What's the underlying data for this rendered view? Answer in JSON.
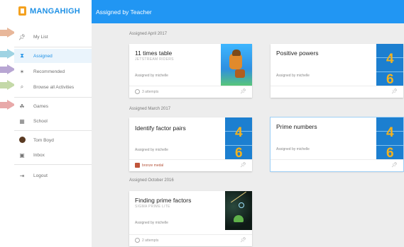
{
  "brand": {
    "name": "MANGAHIGH"
  },
  "topbar": {
    "title": "Assigned by Teacher"
  },
  "sidebar": {
    "items": [
      {
        "label": "My List",
        "icon": "pin-icon"
      },
      {
        "label": "Assigned",
        "icon": "hourglass-icon",
        "active": true
      },
      {
        "label": "Recommended",
        "icon": "magic-wand-icon"
      },
      {
        "label": "Browse all Activities",
        "icon": "search-icon"
      },
      {
        "label": "Games",
        "icon": "gamepad-icon"
      },
      {
        "label": "School",
        "icon": "school-icon"
      },
      {
        "label": "Tom Boyd",
        "icon": "avatar"
      },
      {
        "label": "Inbox",
        "icon": "inbox-icon"
      },
      {
        "label": "Logout",
        "icon": "logout-icon"
      }
    ]
  },
  "colors": {
    "accent": "#2196f3",
    "brand_orange": "#f4a11f",
    "tile_blue": "#1c7fd0",
    "digit_yellow": "#f4b31e"
  },
  "sections": [
    {
      "heading": "Assigned April 2017",
      "cards": [
        {
          "title": "11 times table",
          "subtitle": "JETSTREAM RIDERS",
          "assigned_by": "Assigned by michelle",
          "footer": "3 attempts",
          "thumb_digits": []
        },
        {
          "title": "Positive powers",
          "assigned_by": "Assigned by michelle",
          "thumb_digits": [
            "4",
            "6"
          ]
        }
      ]
    },
    {
      "heading": "Assigned March 2017",
      "cards": [
        {
          "title": "Identify factor pairs",
          "assigned_by": "Assigned by michelle",
          "footer": "bronze medal",
          "thumb_digits": [
            "4",
            "6"
          ]
        },
        {
          "title": "Prime numbers",
          "assigned_by": "Assigned by michelle",
          "thumb_digits": [
            "4",
            "6"
          ]
        }
      ]
    },
    {
      "heading": "Assigned October 2016",
      "cards": [
        {
          "title": "Finding prime factors",
          "subtitle": "SIGMA PRIME LITE",
          "assigned_by": "Assigned by michelle",
          "footer": "2 attempts",
          "thumb_digits": []
        }
      ]
    }
  ]
}
